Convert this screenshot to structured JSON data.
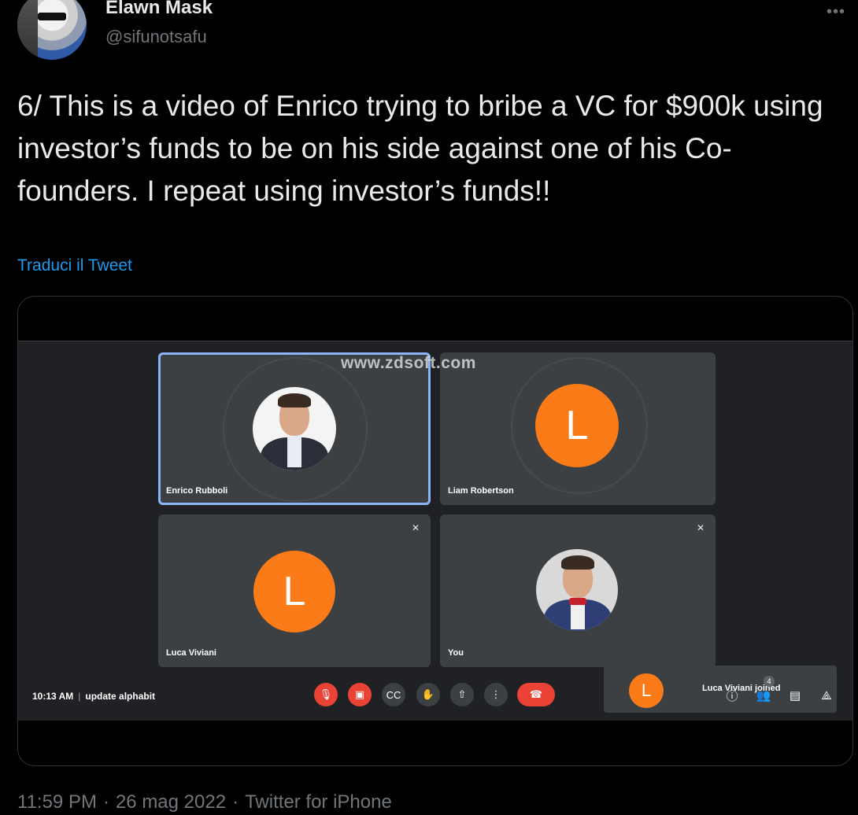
{
  "tweet": {
    "author_name": "Elawn Mask",
    "author_handle": "@sifunotsafu",
    "more_label": "•••",
    "text": "6/ This is a video of Enrico trying to bribe a VC for $900k using investor’s funds to be on his side against one of his Co-founders. I repeat using investor’s funds!!",
    "translate_label": "Traduci il Tweet",
    "footer": {
      "time": "11:59 PM",
      "date": "26 mag 2022",
      "source": "Twitter for iPhone"
    }
  },
  "video": {
    "watermark": "www.zdsoft.com",
    "participants": [
      {
        "name": "Enrico Rubboli",
        "avatar": "photo",
        "active": true
      },
      {
        "name": "Liam Robertson",
        "avatar_letter": "L"
      },
      {
        "name": "Luca Viviani",
        "avatar_letter": "L",
        "muted": true
      },
      {
        "name": "You",
        "avatar": "photo",
        "muted": true
      }
    ],
    "toast": {
      "letter": "L",
      "text": "Luca Viviani joined"
    },
    "meeting_time": "10:13 AM",
    "meeting_name": "update alphabit",
    "people_count": "4",
    "controls": [
      "mic-off-icon",
      "camera-off-icon",
      "captions-icon",
      "raise-hand-icon",
      "present-icon",
      "more-options-icon",
      "end-call-icon"
    ],
    "right_icons": [
      "info-icon",
      "people-icon",
      "chat-icon",
      "activities-icon"
    ],
    "colors": {
      "accent_orange": "#fa7b17",
      "danger_red": "#ea4335",
      "active_border": "#8ab4f8"
    }
  }
}
